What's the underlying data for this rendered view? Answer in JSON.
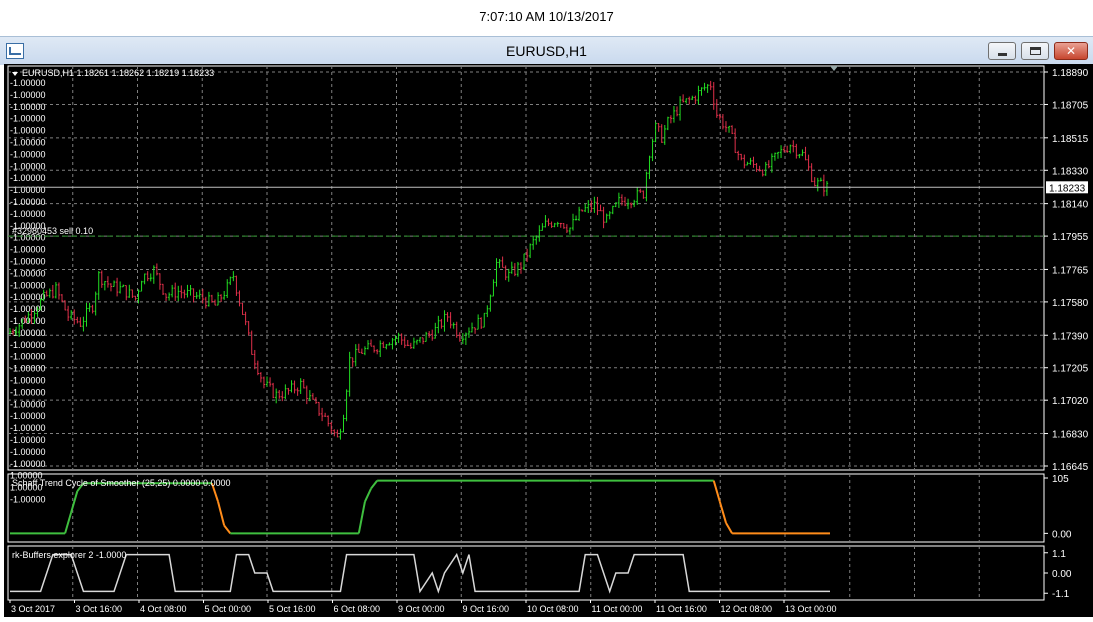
{
  "timestamp": "7:07:10 AM 10/13/2017",
  "window": {
    "title": "EURUSD,H1",
    "close_glyph": "✕"
  },
  "chart_data": {
    "type": "candlestick",
    "header": "EURUSD,H1  1.18261 1.18262 1.18219 1.18233",
    "symbol": "EURUSD",
    "timeframe": "H1",
    "ohlc": {
      "open": 1.18261,
      "high": 1.18262,
      "low": 1.18219,
      "close": 1.18233
    },
    "price_ticks": [
      "1.18890",
      "1.18705",
      "1.18515",
      "1.18330",
      "1.18140",
      "1.17955",
      "1.17765",
      "1.17580",
      "1.17390",
      "1.17205",
      "1.17020",
      "1.16830",
      "1.16645"
    ],
    "ylim": [
      1.16645,
      1.1889
    ],
    "current_price_label": "1.18233",
    "current_price": 1.18233,
    "left_buffer_values": [
      "-1.00000",
      "-1.00000",
      "-1.00000",
      "-1.00000",
      "-1.00000",
      "-1.00000",
      "-1.00000",
      "-1.00000",
      "-1.00000",
      "-1.00000",
      "-1.00000",
      "-1.00000",
      "-1.00000",
      "-1.00000",
      "-1.00000",
      "-1.00000",
      "-1.00000",
      "-1.00000",
      "-1.00000",
      "-1.00000",
      "-1.00000",
      "-1.00000",
      "-1.00000",
      "-1.00000",
      "-1.00000",
      "-1.00000",
      "-1.00000",
      "-1.00000",
      "-1.00000",
      "-1.00000",
      "-1.00000",
      "-1.00000",
      "-1.00000",
      "1.00000",
      "1.00000",
      "-1.00000"
    ],
    "order_label": "#32980453 sell 0.10",
    "order_price": 1.17955,
    "x_tick_labels": [
      "3 Oct 2017",
      "3 Oct 16:00",
      "4 Oct 08:00",
      "5 Oct 00:00",
      "5 Oct 16:00",
      "6 Oct 08:00",
      "9 Oct 00:00",
      "9 Oct 16:00",
      "10 Oct 08:00",
      "11 Oct 00:00",
      "11 Oct 16:00",
      "12 Oct 08:00",
      "13 Oct 00:00"
    ],
    "price_path": [
      [
        0,
        1.174
      ],
      [
        4,
        1.1745
      ],
      [
        8,
        1.1752
      ],
      [
        12,
        1.176
      ],
      [
        16,
        1.1765
      ],
      [
        20,
        1.175
      ],
      [
        24,
        1.1746
      ],
      [
        28,
        1.1756
      ],
      [
        30,
        1.1773
      ],
      [
        34,
        1.1767
      ],
      [
        38,
        1.1765
      ],
      [
        42,
        1.176
      ],
      [
        44,
        1.1772
      ],
      [
        48,
        1.1776
      ],
      [
        52,
        1.1762
      ],
      [
        56,
        1.1764
      ],
      [
        60,
        1.1762
      ],
      [
        64,
        1.176
      ],
      [
        68,
        1.1756
      ],
      [
        72,
        1.1766
      ],
      [
        74,
        1.1773
      ],
      [
        78,
        1.1745
      ],
      [
        80,
        1.173
      ],
      [
        84,
        1.1711
      ],
      [
        88,
        1.1705
      ],
      [
        92,
        1.1707
      ],
      [
        96,
        1.1711
      ],
      [
        100,
        1.17
      ],
      [
        104,
        1.1692
      ],
      [
        108,
        1.168
      ],
      [
        110,
        1.1695
      ],
      [
        112,
        1.1725
      ],
      [
        116,
        1.173
      ],
      [
        120,
        1.1732
      ],
      [
        124,
        1.1736
      ],
      [
        128,
        1.1738
      ],
      [
        132,
        1.1732
      ],
      [
        136,
        1.1737
      ],
      [
        140,
        1.1742
      ],
      [
        144,
        1.175
      ],
      [
        148,
        1.1739
      ],
      [
        152,
        1.1744
      ],
      [
        156,
        1.1748
      ],
      [
        160,
        1.178
      ],
      [
        164,
        1.1773
      ],
      [
        168,
        1.1779
      ],
      [
        172,
        1.1792
      ],
      [
        176,
        1.1802
      ],
      [
        180,
        1.1805
      ],
      [
        184,
        1.18
      ],
      [
        188,
        1.181
      ],
      [
        192,
        1.1813
      ],
      [
        196,
        1.1804
      ],
      [
        200,
        1.1815
      ],
      [
        204,
        1.1817
      ],
      [
        208,
        1.182
      ],
      [
        210,
        1.1844
      ],
      [
        212,
        1.1857
      ],
      [
        214,
        1.1852
      ],
      [
        216,
        1.186
      ],
      [
        220,
        1.187
      ],
      [
        224,
        1.1874
      ],
      [
        228,
        1.188
      ],
      [
        230,
        1.1882
      ],
      [
        232,
        1.1865
      ],
      [
        236,
        1.1855
      ],
      [
        240,
        1.1838
      ],
      [
        244,
        1.1836
      ],
      [
        248,
        1.1833
      ],
      [
        252,
        1.1842
      ],
      [
        256,
        1.1848
      ],
      [
        260,
        1.1842
      ],
      [
        264,
        1.1826
      ],
      [
        268,
        1.18233
      ]
    ],
    "indicators": [
      {
        "name": "Schaff Trend Cycle of Smoother (25,25)",
        "label": "Schaff Trend Cycle of Smoother (25,25) 0.0000 0.0000",
        "ticks": [
          "105",
          "0.00"
        ],
        "ylim": [
          -5,
          105
        ],
        "path": [
          [
            0,
            0
          ],
          [
            18,
            0
          ],
          [
            20,
            40
          ],
          [
            22,
            80
          ],
          [
            24,
            95
          ],
          [
            36,
            95
          ],
          [
            66,
            95
          ],
          [
            68,
            60
          ],
          [
            70,
            15
          ],
          [
            72,
            0
          ],
          [
            114,
            0
          ],
          [
            116,
            60
          ],
          [
            118,
            85
          ],
          [
            120,
            100
          ],
          [
            186,
            100
          ],
          [
            230,
            100
          ],
          [
            232,
            60
          ],
          [
            234,
            20
          ],
          [
            236,
            0
          ],
          [
            268,
            0
          ]
        ],
        "up_color": "#3fbf3f",
        "down_color": "#ff8c1a",
        "down_ranges": [
          [
            66,
            72
          ],
          [
            230,
            268
          ]
        ]
      },
      {
        "name": "rk-Buffers explorer 2",
        "label": "rk-Buffers explorer 2 -1.0000",
        "ticks": [
          "1.1",
          "0.00",
          "-1.1"
        ],
        "ylim": [
          -1.25,
          1.25
        ],
        "color": "#d8d8d8",
        "step_path": [
          [
            0,
            -1
          ],
          [
            10,
            -1
          ],
          [
            12,
            0
          ],
          [
            14,
            1
          ],
          [
            20,
            1
          ],
          [
            22,
            0
          ],
          [
            24,
            -1
          ],
          [
            34,
            -1
          ],
          [
            36,
            0
          ],
          [
            38,
            1
          ],
          [
            52,
            1
          ],
          [
            54,
            -1
          ],
          [
            72,
            -1
          ],
          [
            74,
            1
          ],
          [
            78,
            1
          ],
          [
            80,
            0
          ],
          [
            84,
            0
          ],
          [
            86,
            -1
          ],
          [
            108,
            -1
          ],
          [
            110,
            1
          ],
          [
            132,
            1
          ],
          [
            134,
            -1
          ],
          [
            138,
            0
          ],
          [
            140,
            -1
          ],
          [
            142,
            0
          ],
          [
            146,
            1
          ],
          [
            148,
            0
          ],
          [
            150,
            1
          ],
          [
            152,
            -1
          ],
          [
            186,
            -1
          ],
          [
            188,
            1
          ],
          [
            192,
            1
          ],
          [
            194,
            0
          ],
          [
            196,
            -1
          ],
          [
            198,
            0
          ],
          [
            202,
            0
          ],
          [
            204,
            1
          ],
          [
            220,
            1
          ],
          [
            222,
            -1
          ],
          [
            268,
            -1
          ]
        ]
      }
    ],
    "colors": {
      "background": "#000000",
      "grid": "#7f7f7f",
      "bull": "#22dd22",
      "bear": "#e0304a",
      "text": "#ffffff",
      "order_line": "#2f8f2f"
    }
  }
}
